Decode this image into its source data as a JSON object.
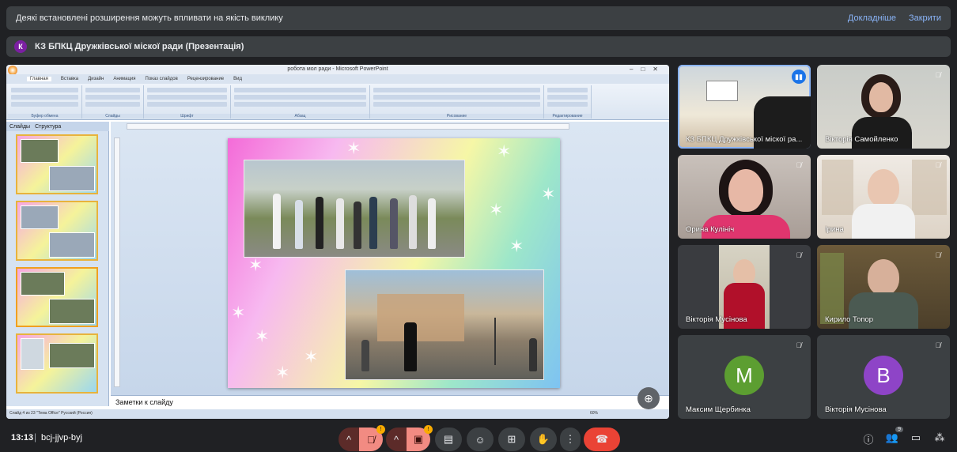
{
  "banner": {
    "message": "Деякі встановлені розширення можуть впливати на якість виклику",
    "details_link": "Докладніше",
    "close_link": "Закрити"
  },
  "presentation": {
    "initial": "К",
    "title": "КЗ БПКЦ Дружківської міскої ради (Презентація)"
  },
  "ppt": {
    "window_title": "робота мол ради - Microsoft PowerPoint",
    "tabs": [
      "Главная",
      "Вставка",
      "Дизайн",
      "Анимация",
      "Показ слайдов",
      "Рецензирование",
      "Вид"
    ],
    "ribbon_groups": [
      "Буфер обмена",
      "Слайды",
      "Шрифт",
      "Абзац",
      "Рисование",
      "Редактирование"
    ],
    "panel_tabs": [
      "Слайды",
      "Структура"
    ],
    "notes_placeholder": "Заметки к слайду",
    "status_text": "Слайд 4 из 23   \"Тема Office\"   Русский (Россия)",
    "zoom": "60%"
  },
  "participants": [
    {
      "name": "КЗ БПКЦ Дружківської міскої ра...",
      "speaking": true
    },
    {
      "name": "Вікторія Самойленко",
      "muted": true
    },
    {
      "name": "Орина Кулініч",
      "muted": true
    },
    {
      "name": "Ірина",
      "muted": true
    },
    {
      "name": "Вікторія Мусінова",
      "muted": true
    },
    {
      "name": "Кирило Топор",
      "muted": true
    },
    {
      "name": "Максим Щербинка",
      "muted": true,
      "initial": "М",
      "color": "#5c9e31"
    },
    {
      "name": "Вікторія Мусінова",
      "muted": true,
      "initial": "В",
      "color": "#8e44c7"
    }
  ],
  "bottom": {
    "time": "13:13",
    "meeting_code": "bcj-jjvp-byj",
    "people_count": "9"
  },
  "colors": {
    "background": "#202124",
    "accent": "#8ab4f8",
    "hangup": "#ea4335",
    "warning": "#f9ab00"
  }
}
